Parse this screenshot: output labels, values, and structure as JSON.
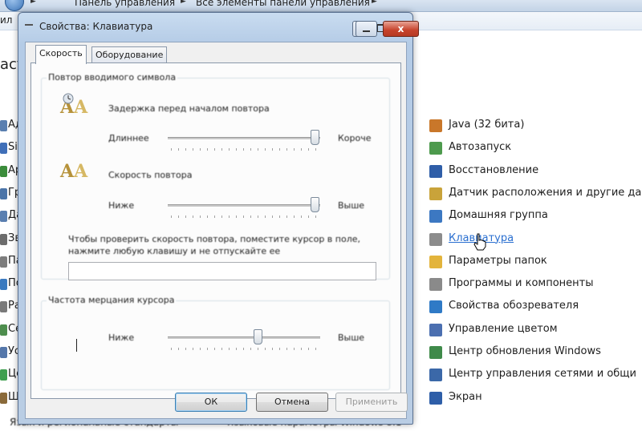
{
  "controlpanel": {
    "breadcrumb_1": "Панель управления",
    "breadcrumb_2": "Все элементы панели управления",
    "menu_left": "ил",
    "left_title": "аст",
    "left_items": [
      {
        "label": "Ад",
        "color": "#5a7fb0"
      },
      {
        "label": "Si",
        "color": "#3f6fb8"
      },
      {
        "label": "Ар",
        "color": "#3b8c3b"
      },
      {
        "label": "Гр",
        "color": "#4b74a8"
      },
      {
        "label": "Да",
        "color": "#5a7fb0"
      },
      {
        "label": "Зв",
        "color": "#6d6d6d"
      },
      {
        "label": "Па",
        "color": "#7d7d7d"
      },
      {
        "label": "По",
        "color": "#3a7abf"
      },
      {
        "label": "Ра",
        "color": "#7a7a7a"
      },
      {
        "label": "Се",
        "color": "#4e8e4e"
      },
      {
        "label": "Ус",
        "color": "#5577aa"
      },
      {
        "label": "Це",
        "color": "#3f9f4f"
      },
      {
        "label": "Ш",
        "color": "#8a6a3a"
      }
    ],
    "bottom_left": "Язык и региональные стандарты",
    "bottom_right": "Языковые параметры Windows 8.1",
    "right_items": [
      {
        "label": "Java (32 бита)",
        "color": "#c9772a"
      },
      {
        "label": "Автозапуск",
        "color": "#4d9a4d"
      },
      {
        "label": "Восстановление",
        "color": "#2f5ea8"
      },
      {
        "label": "Датчик расположения и другие да",
        "color": "#c9a33a"
      },
      {
        "label": "Домашняя группа",
        "color": "#3c78c2"
      },
      {
        "label": "Клавиатура",
        "color": "#8c8c8c"
      },
      {
        "label": "Параметры папок",
        "color": "#e3b43c"
      },
      {
        "label": "Программы и компоненты",
        "color": "#8a8a8a"
      },
      {
        "label": "Свойства обозревателя",
        "color": "#2f7ac6"
      },
      {
        "label": "Управление цветом",
        "color": "#4b6fb0"
      },
      {
        "label": "Центр обновления Windows",
        "color": "#3f8a4a"
      },
      {
        "label": "Центр управления сетями и общи",
        "color": "#3b68a8"
      },
      {
        "label": "Экран",
        "color": "#2e5ea8"
      }
    ]
  },
  "dialog": {
    "title": "Свойства: Клавиатура",
    "close_label": "x",
    "tabs": [
      "Скорость",
      "Оборудование"
    ],
    "group_repeat": "Повтор вводимого символа",
    "repeat_delay_label": "Задержка перед началом повтора",
    "repeat_delay_min": "Длиннее",
    "repeat_delay_max": "Короче",
    "repeat_delay_value": 1.0,
    "repeat_rate_label": "Скорость повтора",
    "repeat_rate_min": "Ниже",
    "repeat_rate_max": "Выше",
    "repeat_rate_value": 1.0,
    "test_hint": "Чтобы проверить скорость повтора, поместите курсор в поле, нажмите любую клавишу и не отпускайте ее",
    "group_cursor": "Частота мерцания курсора",
    "blink_min": "Ниже",
    "blink_max": "Выше",
    "blink_value": 0.6,
    "ok": "ОК",
    "cancel": "Отмена",
    "apply": "Применить"
  }
}
